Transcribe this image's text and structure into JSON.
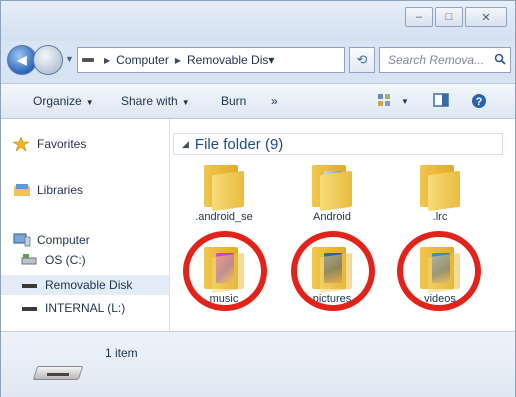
{
  "window": {
    "buttons": {
      "minimize": "–",
      "maximize": "□",
      "close": "✕"
    }
  },
  "nav": {
    "back_glyph": "◀",
    "breadcrumb": [
      "Computer",
      "Removable Dis▾"
    ],
    "refresh_glyph": "⟲",
    "search_placeholder": "Search Remova..."
  },
  "toolbar": {
    "organize": "Organize",
    "share_with": "Share with",
    "burn": "Burn",
    "more": "»"
  },
  "sidebar": {
    "favorites": "Favorites",
    "libraries": "Libraries",
    "computer": "Computer",
    "os": "OS (C:)",
    "removable": "Removable Disk",
    "internal": "INTERNAL (L:)"
  },
  "content": {
    "group_header": "File folder (9)",
    "folders": [
      {
        "label": ".android_se"
      },
      {
        "label": "Android"
      },
      {
        "label": ".lrc"
      },
      {
        "label": "music",
        "circled": true
      },
      {
        "label": "pictures",
        "circled": true
      },
      {
        "label": "videos",
        "circled": true
      }
    ]
  },
  "status": {
    "text": "1 item"
  },
  "colors": {
    "highlight_ring": "#e2231a",
    "accent": "#1e4a8a"
  },
  "icons": [
    "back-arrow-icon",
    "forward-arrow-icon",
    "drive-icon",
    "refresh-icon",
    "search-icon",
    "view-icon",
    "preview-pane-icon",
    "help-icon",
    "star-icon",
    "library-icon",
    "computer-icon",
    "folder-icon",
    "usb-drive-icon"
  ]
}
